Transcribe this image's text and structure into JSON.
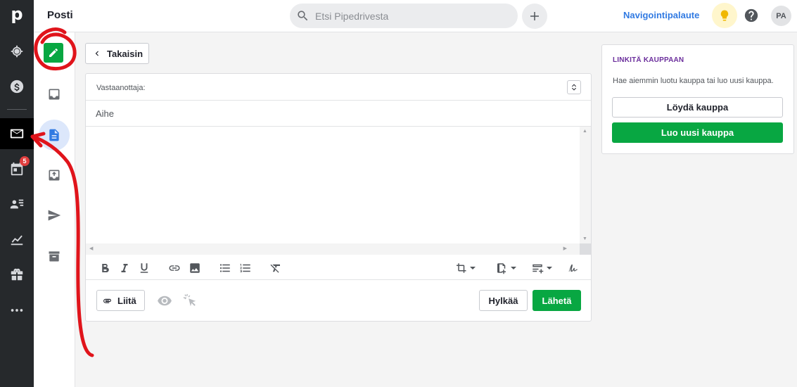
{
  "app": {
    "title": "Posti"
  },
  "search": {
    "placeholder": "Etsi Pipedrivesta"
  },
  "header": {
    "feedback_link": "Navigointipalaute",
    "avatar_initials": "PA"
  },
  "main_nav": {
    "logo": "p",
    "items": [
      {
        "icon": "target-icon",
        "active": false
      },
      {
        "icon": "dollar-icon",
        "active": false
      },
      {
        "icon": "mail-icon",
        "active": true
      },
      {
        "icon": "calendar-icon",
        "active": false,
        "badge": "5"
      },
      {
        "icon": "contacts-icon",
        "active": false
      },
      {
        "icon": "chart-icon",
        "active": false
      },
      {
        "icon": "products-icon",
        "active": false
      },
      {
        "icon": "more-icon",
        "active": false
      }
    ]
  },
  "mail_nav": {
    "items": [
      {
        "icon": "compose-icon",
        "active": false
      },
      {
        "icon": "inbox-icon",
        "active": false
      },
      {
        "icon": "drafts-icon",
        "active": true
      },
      {
        "icon": "outbox-icon",
        "active": false
      },
      {
        "icon": "sent-icon",
        "active": false
      },
      {
        "icon": "archive-icon",
        "active": false
      }
    ]
  },
  "composer": {
    "back_label": "Takaisin",
    "to_label": "Vastaanottaja:",
    "subject_placeholder": "Aihe",
    "subject_value": "",
    "attach_label": "Liitä",
    "discard_label": "Hylkää",
    "send_label": "Lähetä"
  },
  "deal_panel": {
    "title": "LINKITÄ KAUPPAAN",
    "description": "Hae aiemmin luotu kauppa tai luo uusi kauppa.",
    "find_label": "Löydä kauppa",
    "create_label": "Luo uusi kauppa"
  },
  "colors": {
    "accent_green": "#08a742",
    "link_blue": "#317ae2",
    "nav_dark": "#26292c",
    "deal_title": "#6b2e9c",
    "annotation_red": "#e0141b"
  }
}
